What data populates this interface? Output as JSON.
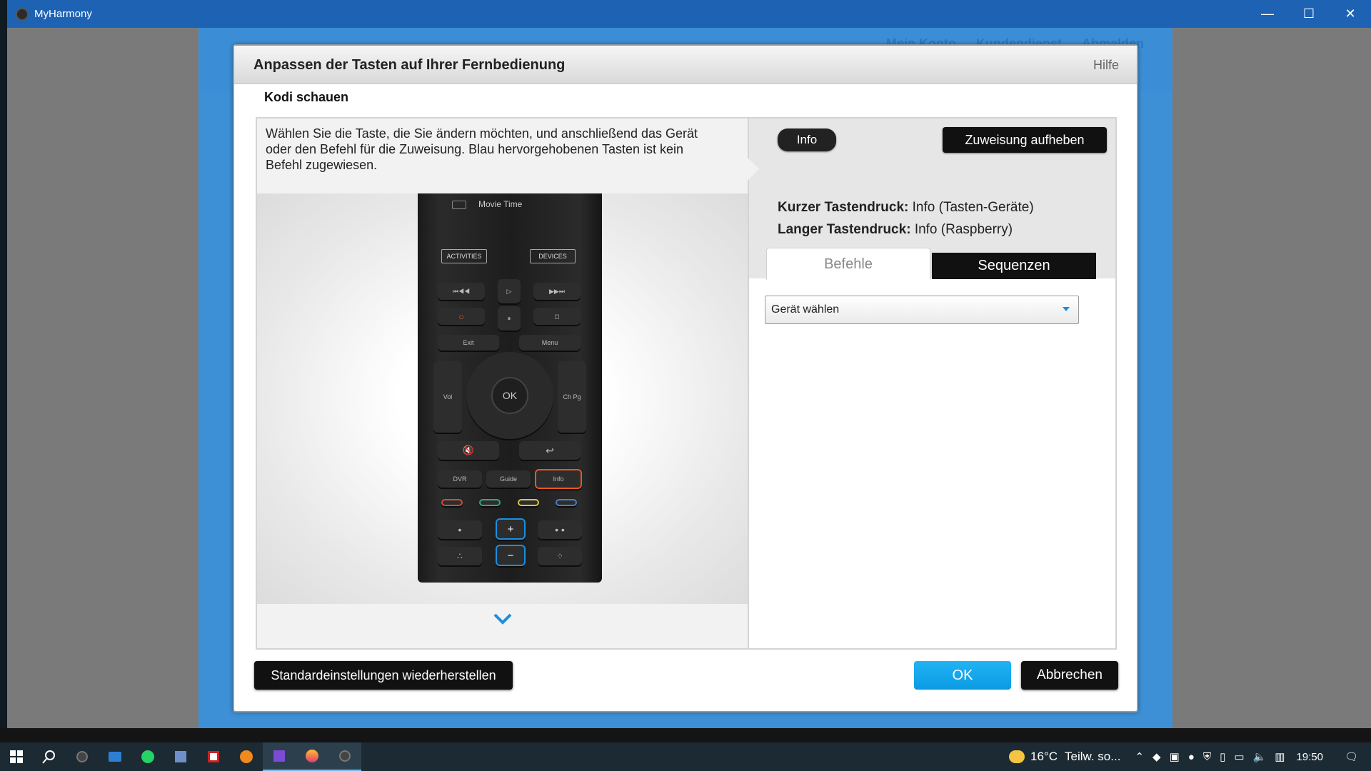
{
  "window": {
    "title": "MyHarmony",
    "minimize": "—",
    "maximize": "☐",
    "close": "✕"
  },
  "background": {
    "links": [
      "Mein Konto",
      "Kundendienst",
      "Abmelden"
    ]
  },
  "dialog": {
    "title": "Anpassen der Tasten auf Ihrer Fernbedienung",
    "help": "Hilfe",
    "activity": "Kodi schauen",
    "instructions": "Wählen Sie die Taste, die Sie ändern möchten, und anschließend das Gerät oder den Befehl für die Zuweisung. Blau hervorgehobenen Tasten ist kein Befehl zugewiesen.",
    "scroll_down_icon": "chevron-down-icon",
    "remote": {
      "screen_title": "Movie Time",
      "activities": "ACTIVITIES",
      "devices": "DEVICES",
      "exit": "Exit",
      "menu": "Menu",
      "ok": "OK",
      "vol": "Vol",
      "ch": "Ch Pg",
      "dvr": "DVR",
      "guide": "Guide",
      "info": "Info",
      "plus": "+",
      "minus": "−"
    },
    "info_button": "Info",
    "unassign_button": "Zuweisung aufheben",
    "short_press_label": "Kurzer Tastendruck:",
    "short_press_value": "Info (Tasten-Geräte)",
    "long_press_label": "Langer Tastendruck:",
    "long_press_value": "Info (Raspberry)",
    "tabs": [
      "Befehle",
      "Sequenzen"
    ],
    "device_select": "Gerät wählen",
    "restore_button": "Standardeinstellungen wiederherstellen",
    "ok_button": "OK",
    "cancel_button": "Abbrechen",
    "colors": {
      "accent": "#1a8fe0",
      "highlight_info": "#e8581f",
      "unassigned": "#1a8fe0"
    }
  },
  "taskbar": {
    "weather_temp": "16°C",
    "weather_text": "Teilw. so...",
    "time": "19:50"
  }
}
